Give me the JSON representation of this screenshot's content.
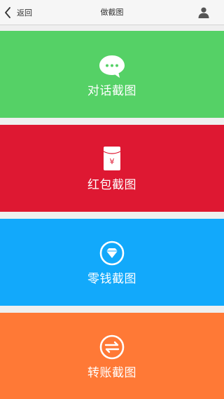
{
  "header": {
    "back_label": "返回",
    "title": "做截图"
  },
  "icons": {
    "back": "chevron-left-icon",
    "user": "user-icon",
    "chat": "chat-bubble-icon",
    "hongbao": "red-envelope-icon",
    "change": "diamond-icon",
    "transfer": "transfer-arrows-icon"
  },
  "colors": {
    "chat": "#55d166",
    "hongbao": "#de1832",
    "change": "#12a9fb",
    "transfer": "#ff7936"
  },
  "cards": [
    {
      "label": "对话截图"
    },
    {
      "label": "红包截图"
    },
    {
      "label": "零钱截图"
    },
    {
      "label": "转账截图"
    }
  ],
  "hongbao_symbol": "¥"
}
